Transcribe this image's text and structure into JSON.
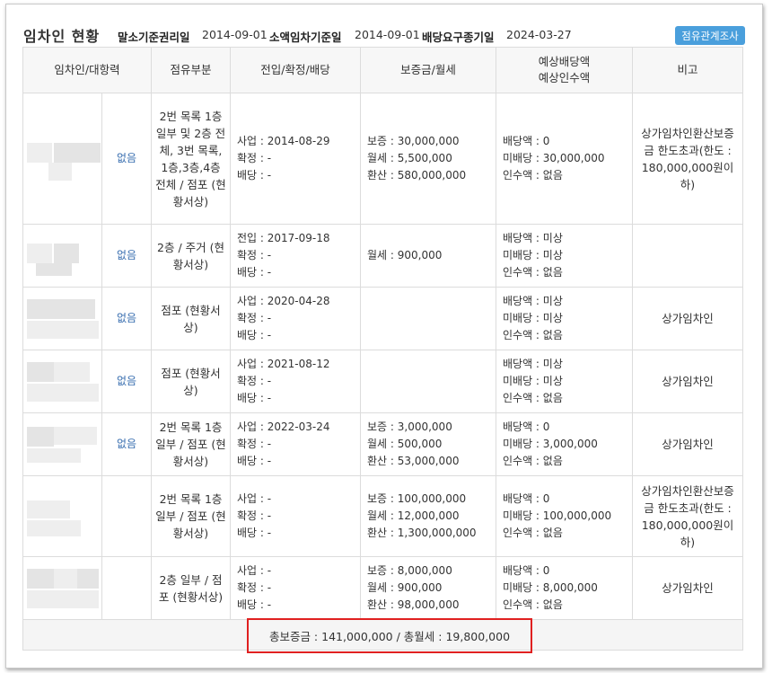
{
  "header": {
    "title": "임차인 현황",
    "dates": [
      {
        "label": "말소기준권리일",
        "value": "2014-09-01"
      },
      {
        "label": "소액임차기준일",
        "value": "2014-09-01"
      },
      {
        "label": "배당요구종기일",
        "value": "2024-03-27"
      }
    ],
    "survey_button": "점유관계조사"
  },
  "table": {
    "columns": [
      "임차인/대항력",
      "점유부분",
      "전입/확정/배당",
      "보증금/월세",
      "예상배당액",
      "예상인수액",
      "비고"
    ],
    "rows": [
      {
        "opposability": "없음",
        "part": "2번 목록 1층 일부 및 2층 전체, 3번 목록, 1층,3층,4층 전체 / 점포 (현황서상)",
        "dates": [
          "사업 : 2014-08-29",
          "확정 : -",
          "배당 : -"
        ],
        "deposit": [
          "보증 : 30,000,000",
          "월세 : 5,500,000",
          "환산 : 580,000,000"
        ],
        "dividend": [
          "배당액 : 0",
          "미배당 : 30,000,000",
          "인수액 : 없음"
        ],
        "note": "상가임차인환산보증금 한도초과(한도 : 180,000,000원이하)"
      },
      {
        "opposability": "없음",
        "part": "2층 / 주거 (현황서상)",
        "dates": [
          "전입 : 2017-09-18",
          "확정 : -",
          "배당 : -"
        ],
        "deposit": [
          "월세 : 900,000"
        ],
        "dividend": [
          "배당액 : 미상",
          "미배당 : 미상",
          "인수액 : 없음"
        ],
        "note": ""
      },
      {
        "opposability": "없음",
        "part": "점포 (현황서상)",
        "dates": [
          "사업 : 2020-04-28",
          "확정 : -",
          "배당 : -"
        ],
        "deposit": [],
        "dividend": [
          "배당액 : 미상",
          "미배당 : 미상",
          "인수액 : 없음"
        ],
        "note": "상가임차인"
      },
      {
        "opposability": "없음",
        "part": "점포 (현황서상)",
        "dates": [
          "사업 : 2021-08-12",
          "확정 : -",
          "배당 : -"
        ],
        "deposit": [],
        "dividend": [
          "배당액 : 미상",
          "미배당 : 미상",
          "인수액 : 없음"
        ],
        "note": "상가임차인"
      },
      {
        "opposability": "없음",
        "part": "2번 목록 1층 일부 / 점포 (현황서상)",
        "dates": [
          "사업 : 2022-03-24",
          "확정 : -",
          "배당 : -"
        ],
        "deposit": [
          "보증 : 3,000,000",
          "월세 : 500,000",
          "환산 : 53,000,000"
        ],
        "dividend": [
          "배당액 : 0",
          "미배당 : 3,000,000",
          "인수액 : 없음"
        ],
        "note": "상가임차인"
      },
      {
        "opposability": "",
        "part": "2번 목록 1층 일부 / 점포 (현황서상)",
        "dates": [
          "사업 : -",
          "확정 : -",
          "배당 : -"
        ],
        "deposit": [
          "보증 : 100,000,000",
          "월세 : 12,000,000",
          "환산 : 1,300,000,000"
        ],
        "dividend": [
          "배당액 : 0",
          "미배당 : 100,000,000",
          "인수액 : 없음"
        ],
        "note": "상가임차인환산보증금 한도초과(한도 : 180,000,000원이하)"
      },
      {
        "opposability": "",
        "part": "2층 일부 / 점포 (현황서상)",
        "dates": [
          "사업 : -",
          "확정 : -",
          "배당 : -"
        ],
        "deposit": [
          "보증 : 8,000,000",
          "월세 : 900,000",
          "환산 : 98,000,000"
        ],
        "dividend": [
          "배당액 : 0",
          "미배당 : 8,000,000",
          "인수액 : 없음"
        ],
        "note": "상가임차인"
      }
    ],
    "totals": "총보증금 : 141,000,000  /  총월세 : 19,800,000"
  }
}
